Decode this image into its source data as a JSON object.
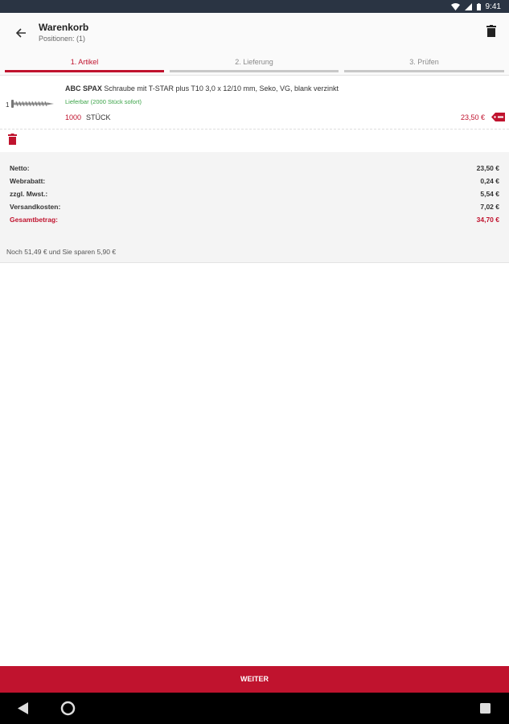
{
  "status": {
    "time": "9:41"
  },
  "appbar": {
    "title": "Warenkorb",
    "subtitle": "Positionen: (1)"
  },
  "tabs": [
    {
      "label": "1. Artikel",
      "active": true
    },
    {
      "label": "2. Lieferung",
      "active": false
    },
    {
      "label": "3. Prüfen",
      "active": false
    }
  ],
  "item": {
    "position": "1",
    "brand": "ABC SPAX",
    "name": "Schraube mit T-STAR plus T10 3,0 x 12/10 mm, Seko, VG, blank verzinkt",
    "availability": "Lieferbar (2000 Stück sofort)",
    "quantity": "1000",
    "unit": "STÜCK",
    "price": "23,50 €"
  },
  "summary": {
    "rows": [
      {
        "label": "Netto:",
        "value": "23,50 €"
      },
      {
        "label": "Webrabatt:",
        "value": "0,24 €"
      },
      {
        "label": "zzgl. Mwst.:",
        "value": "5,54 €"
      },
      {
        "label": "Versandkosten:",
        "value": "7,02 €"
      },
      {
        "label": "Gesamtbetrag:",
        "value": "34,70 €"
      }
    ],
    "savings": "Noch 51,49 € und Sie sparen 5,90 €"
  },
  "footer": {
    "button_label": "WEITER"
  },
  "colors": {
    "accent": "#c0132e",
    "available": "#3aa347",
    "statusbar": "#2a3443"
  },
  "icons": [
    "back-arrow-icon",
    "trash-icon",
    "tag-icon",
    "back-nav-icon",
    "home-nav-icon",
    "recents-nav-icon"
  ]
}
